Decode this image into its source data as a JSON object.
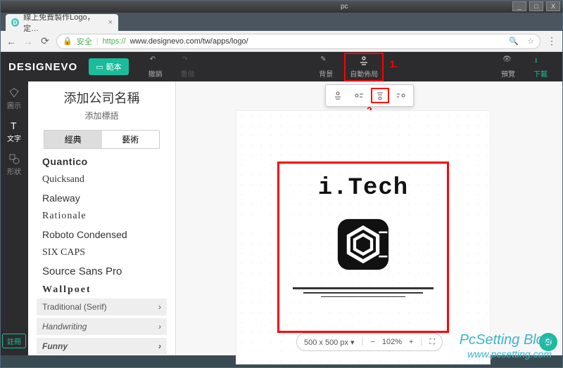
{
  "window": {
    "pc_label": "pc",
    "min": "_",
    "max": "□",
    "close": "X"
  },
  "browser": {
    "tab_title": "線上免費製作Logo，定…",
    "secure_label": "安全",
    "url_prefix": "https://",
    "url_rest": "www.designevo.com/tw/apps/logo/"
  },
  "header": {
    "logo": "DESIGNEVO",
    "template_btn": "範本",
    "undo": "撤銷",
    "redo": "重做",
    "bg": "背景",
    "autolayout": "自動佈局",
    "preview": "預覽",
    "download": "下載"
  },
  "annotations": {
    "one": "1.",
    "two": "2."
  },
  "rail": {
    "icon": "圖示",
    "text": "文字",
    "shape": "形狀",
    "register": "註冊"
  },
  "panel": {
    "company": "添加公司名稱",
    "tagline": "添加標語",
    "tab_classic": "經典",
    "tab_art": "藝術",
    "fonts": [
      "Quantico",
      "Quicksand",
      "Raleway",
      "Rationale",
      "Roboto Condensed",
      "Six Caps",
      "Source Sans Pro",
      "Wallpoet"
    ],
    "cat_serif": "Traditional (Serif)",
    "cat_hand": "Handwriting",
    "cat_funny": "Funny"
  },
  "canvas": {
    "logo_text": "i.Tech",
    "size_label": "500 x 500 px",
    "zoom": "102%"
  },
  "watermark": {
    "l1": "PcSetting Blog",
    "l2": "www.pcsetting.com"
  }
}
